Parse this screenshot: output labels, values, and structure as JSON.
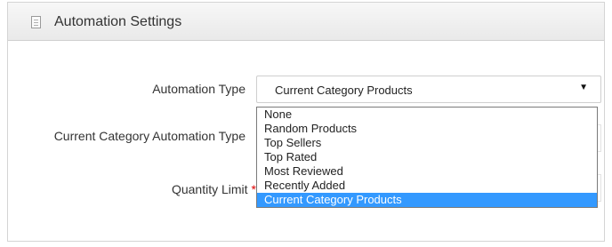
{
  "panel": {
    "title": "Automation Settings",
    "icon": "document-icon"
  },
  "form": {
    "automation_type_label": "Automation Type",
    "category_type_label": "Current Category Automation Type",
    "quantity_label": "Quantity Limit",
    "required_marker": "*",
    "automation_type_value": "Current Category Products",
    "dropdown_arrow": "▼"
  },
  "dropdown": {
    "options": [
      "None",
      "Random Products",
      "Top Sellers",
      "Top Rated",
      "Most Reviewed",
      "Recently Added",
      "Current Category Products"
    ],
    "selected_index": 6,
    "highlight_color": "#3399ff"
  }
}
